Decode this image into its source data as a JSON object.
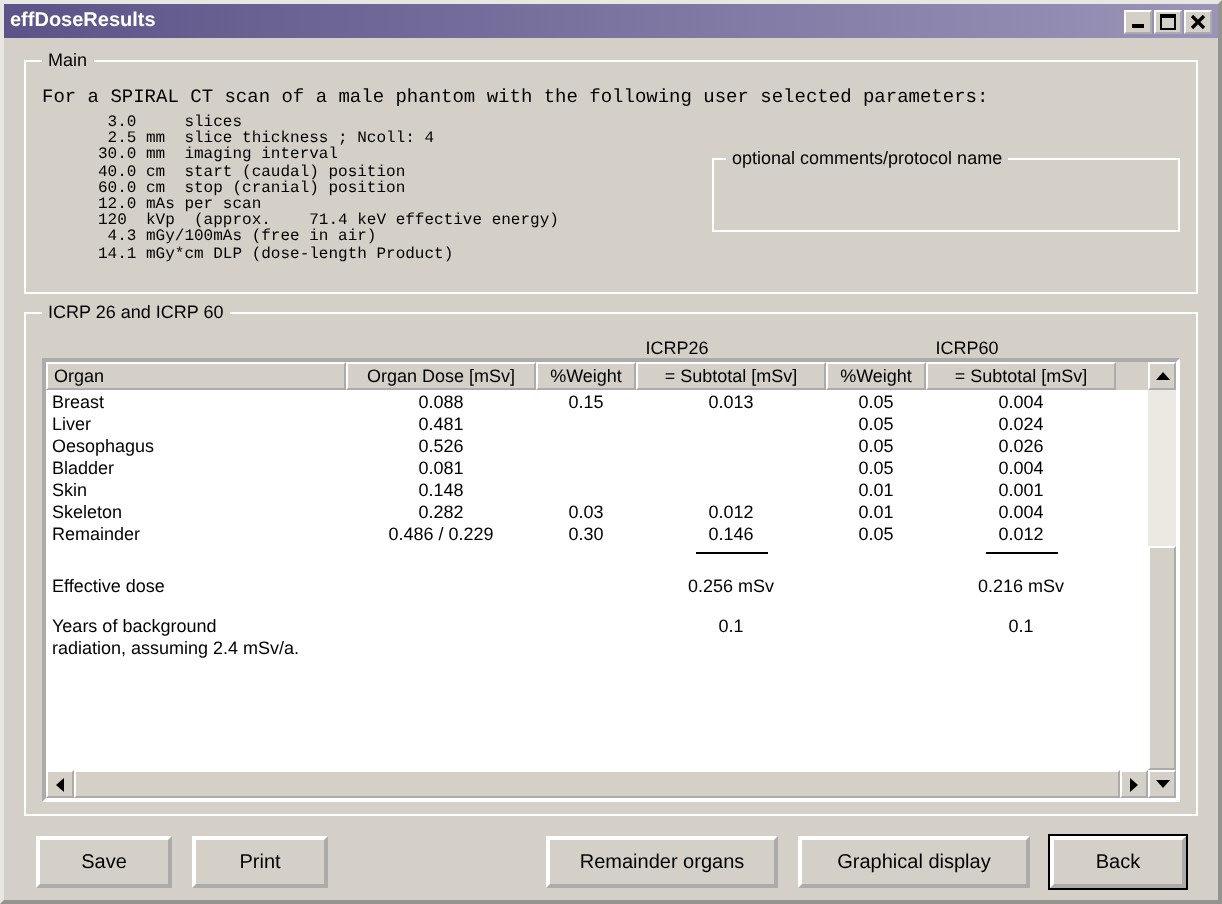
{
  "window": {
    "title": "effDoseResults"
  },
  "main": {
    "label": "Main",
    "intro": "For a SPIRAL CT scan of a male phantom with the following user selected parameters:",
    "parameters": [
      " 3.0     slices",
      " 2.5 mm  slice thickness ; Ncoll: 4",
      "30.0 mm  imaging interval",
      "40.0 cm  start (caudal) position",
      "60.0 cm  stop (cranial) position",
      "12.0 mAs per scan",
      "120  kVp  (approx.    71.4 keV effective energy)",
      " 4.3 mGy/100mAs (free in air)",
      "14.1 mGy*cm DLP (dose-length Product)"
    ],
    "comments_label": "optional comments/protocol name"
  },
  "results": {
    "label": "ICRP 26 and ICRP 60",
    "groups": [
      "ICRP26",
      "ICRP60"
    ],
    "columns": [
      "Organ",
      "Organ Dose [mSv]",
      "%Weight",
      "= Subtotal [mSv]",
      "%Weight",
      "= Subtotal [mSv]"
    ],
    "rows": [
      {
        "kind": "organ",
        "cells": [
          "Breast",
          "0.088",
          "0.15",
          "0.013",
          "0.05",
          "0.004"
        ]
      },
      {
        "kind": "organ",
        "cells": [
          "Liver",
          "0.481",
          "",
          "",
          "0.05",
          "0.024"
        ]
      },
      {
        "kind": "organ",
        "cells": [
          "Oesophagus",
          "0.526",
          "",
          "",
          "0.05",
          "0.026"
        ]
      },
      {
        "kind": "organ",
        "cells": [
          "Bladder",
          "0.081",
          "",
          "",
          "0.05",
          "0.004"
        ]
      },
      {
        "kind": "organ",
        "cells": [
          "Skin",
          "0.148",
          "",
          "",
          "0.01",
          "0.001"
        ]
      },
      {
        "kind": "organ",
        "cells": [
          "Skeleton",
          "0.282",
          "0.03",
          "0.012",
          "0.01",
          "0.004"
        ]
      },
      {
        "kind": "organ",
        "cells": [
          "Remainder",
          "0.486 / 0.229",
          "0.30",
          "0.146",
          "0.05",
          "0.012"
        ]
      },
      {
        "kind": "rule",
        "cells": []
      },
      {
        "kind": "total",
        "cells": [
          "Effective dose",
          "",
          "",
          "0.256 mSv",
          "",
          "0.216 mSv"
        ]
      },
      {
        "kind": "total",
        "cells": [
          "Years of background\nradiation, assuming 2.4 mSv/a.",
          "",
          "",
          "0.1",
          "",
          "0.1"
        ]
      }
    ]
  },
  "buttons": [
    "Save",
    "Print",
    "Remainder organs",
    "Graphical display",
    "Back"
  ]
}
